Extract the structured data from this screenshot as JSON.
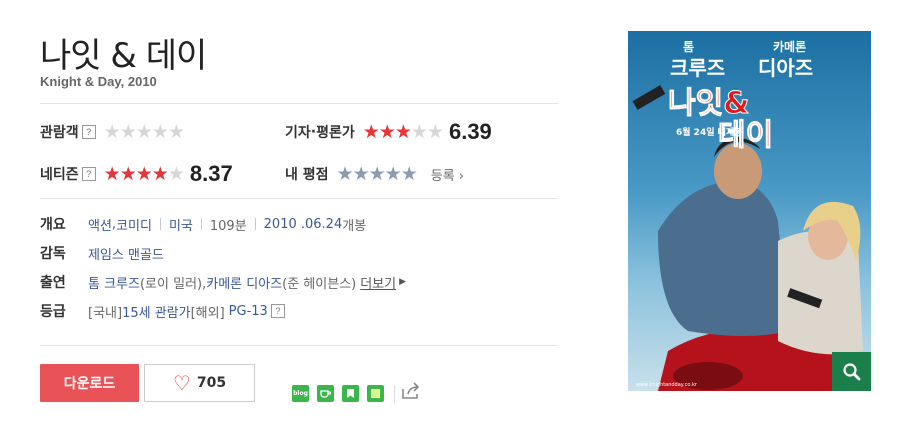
{
  "movie": {
    "title_ko": "나잇 & 데이",
    "title_en_year": "Knight & Day, 2010"
  },
  "ratings": {
    "audience": {
      "label": "관람객",
      "help": "?",
      "stars": 0
    },
    "critics": {
      "label_a": "기자",
      "dot": "·",
      "label_b": "평론가",
      "score": "6.39",
      "stars": 3.2
    },
    "netizen": {
      "label": "네티즌",
      "help": "?",
      "score": "8.37",
      "stars": 4.2
    },
    "mine": {
      "label": "내 평점",
      "stars": 0,
      "register_label": "등록"
    }
  },
  "info": {
    "overview_label": "개요",
    "genre_1": "액션",
    "genre_sep": ", ",
    "genre_2": "코미디",
    "country": "미국",
    "runtime": "109분",
    "release_date": "2010 .06.24",
    "release_suffix": " 개봉",
    "director_label": "감독",
    "director": "제임스 맨골드",
    "cast_label": "출연",
    "actor_1": "톰 크루즈",
    "role_1": "(로이 밀러), ",
    "actor_2": "카메론 디아즈",
    "role_2": "(준 헤이븐스)",
    "more_label": "더보기",
    "grade_label": "등급",
    "grade_domestic_prefix": "[국내] ",
    "grade_domestic": "15세 관람가",
    "grade_overseas_prefix": " [해외] ",
    "grade_overseas": "PG-13",
    "grade_help": "?"
  },
  "actions": {
    "download_label": "다운로드",
    "like_count": "705"
  },
  "share": {
    "icons": [
      "blog-icon",
      "cafe-icon",
      "bookmark-icon",
      "memo-icon",
      "share-icon"
    ],
    "blog_text": "blog"
  },
  "poster": {
    "top_names": "톰    카메론",
    "names_line": "크루즈 디아즈",
    "logo_text": "나잇&데이",
    "date_text": "6월 24일 대개봉",
    "bottom_text": "www.knightandday.co.kr"
  },
  "colors": {
    "accent_red": "#e8353b",
    "link_blue": "#3a5896",
    "download_bg": "#e95357",
    "share_green": "#3bb64a",
    "zoom_green": "#1a7f4a"
  }
}
